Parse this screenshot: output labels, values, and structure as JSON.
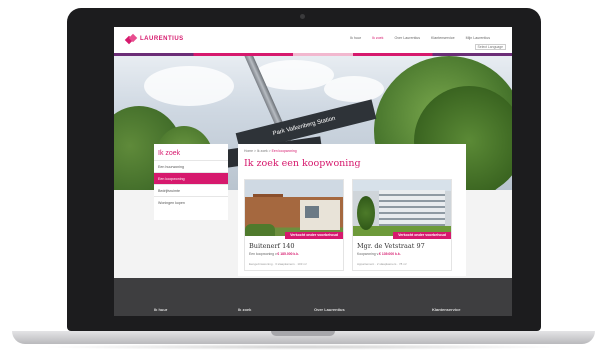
{
  "site": {
    "logo_text": "LAURENTIUS",
    "brand_color": "#d6196d",
    "nav": [
      "Ik huur",
      "Ik zoek",
      "Over Laurentius",
      "Klantenservice",
      "Mijn Laurentius"
    ],
    "nav_active": "Ik zoek",
    "language": "Select Language"
  },
  "hero": {
    "sign_text": "Park Valkenberg Station"
  },
  "sidebar": {
    "title": "Ik zoek",
    "items": [
      {
        "label": "Een huurwoning",
        "active": false
      },
      {
        "label": "Een koopwoning",
        "active": true
      },
      {
        "label": "Bedrijfsruimte",
        "active": false
      },
      {
        "label": "Woningen kopen",
        "active": false
      }
    ]
  },
  "main": {
    "breadcrumb": {
      "home": "Home",
      "sep1": ">",
      "parent": "Ik zoek",
      "sep2": ">",
      "current": "Een koopwoning"
    },
    "title": "Ik zoek een koopwoning",
    "cards": [
      {
        "ribbon": "Verkocht onder voorbehoud",
        "address": "Buitenerf 140",
        "price_prefix": "Een koopwoning v.",
        "price": "€ 185.000 k.k.",
        "meta": "Eengezinswoning · 3 slaapkamers · 103 m²"
      },
      {
        "ribbon": "Verkocht onder voorbehoud",
        "address": "Mgr. de Vetstraat 97",
        "price_prefix": "Koopwoning v.",
        "price": "€ 139.000 k.k.",
        "meta": "Appartement · 2 slaapkamers · 78 m²"
      }
    ]
  },
  "footer": {
    "columns": [
      "Ik huur",
      "Ik zoek",
      "Over Laurentius",
      "Klantenservice"
    ]
  }
}
